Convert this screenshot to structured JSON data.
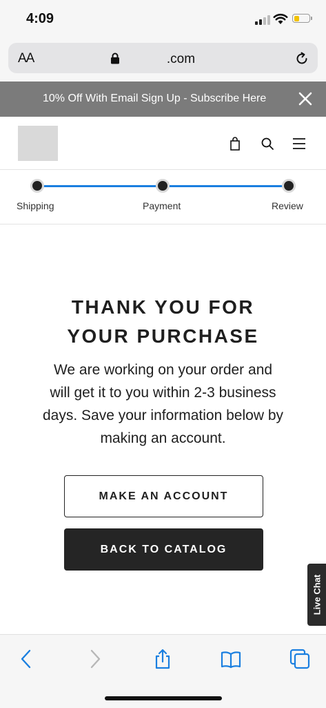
{
  "status_bar": {
    "time": "4:09",
    "battery_level": 0.35,
    "battery_color": "#f2c200"
  },
  "browser": {
    "text_size_label": "AA",
    "domain": ".com",
    "lock_icon": "lock-icon",
    "reload_icon": "reload-icon"
  },
  "promo_banner": {
    "text": "10% Off With Email Sign Up - Subscribe Here",
    "close_icon": "close-icon"
  },
  "header": {
    "icons": [
      "shopping-bag-icon",
      "search-icon",
      "hamburger-menu-icon"
    ]
  },
  "checkout_steps": {
    "accent_color": "#1a7fe0",
    "steps": [
      {
        "label": "Shipping"
      },
      {
        "label": "Payment"
      },
      {
        "label": "Review"
      }
    ]
  },
  "confirmation": {
    "title_line1": "THANK YOU FOR",
    "title_line2": "YOUR PURCHASE",
    "message_line1": "We are working on your order and",
    "message_line2": "will get it to you within 2-3 business",
    "message_line3": "days. Save your information below by",
    "message_line4": "making an account.",
    "make_account_label": "MAKE AN ACCOUNT",
    "back_to_catalog_label": "BACK TO CATALOG"
  },
  "live_chat": {
    "label": "Live Chat"
  },
  "toolbar": {
    "accent_color": "#1a7fe0",
    "icons": [
      "back-icon",
      "forward-icon",
      "share-icon",
      "bookmarks-icon",
      "tabs-icon"
    ]
  }
}
